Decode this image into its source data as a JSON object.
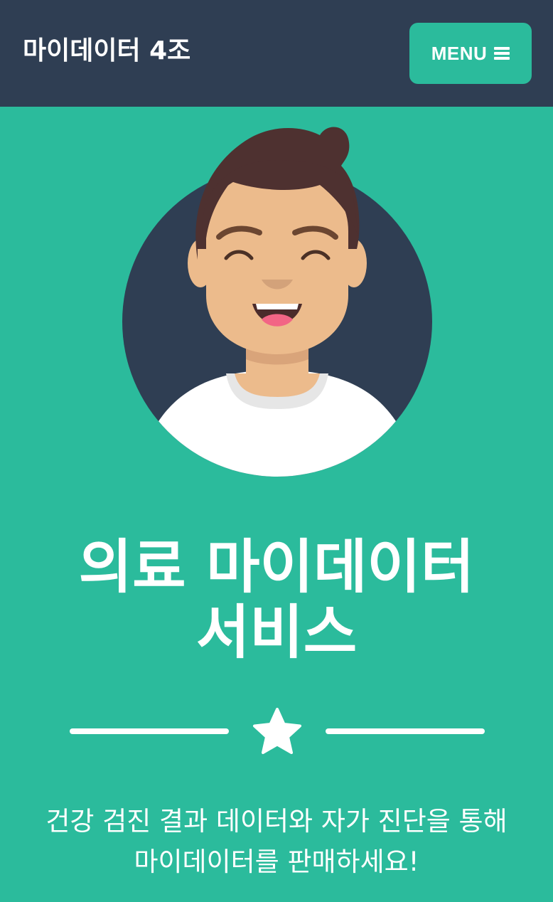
{
  "navbar": {
    "brand": "마이데이터 4조",
    "menu_label": "MENU",
    "menu_icon": "hamburger-icon"
  },
  "hero": {
    "avatar_icon": "avatar-illustration",
    "title_line1": "의료 마이데이터",
    "title_line2": "서비스",
    "divider_icon": "star-icon",
    "subtitle_line1": "건강 검진 결과 데이터와 자가 진단을 통해",
    "subtitle_line2": "마이데이터를 판매하세요!"
  },
  "colors": {
    "navbar_bg": "#2f3e53",
    "accent": "#2bbb9c",
    "text": "#ffffff"
  }
}
